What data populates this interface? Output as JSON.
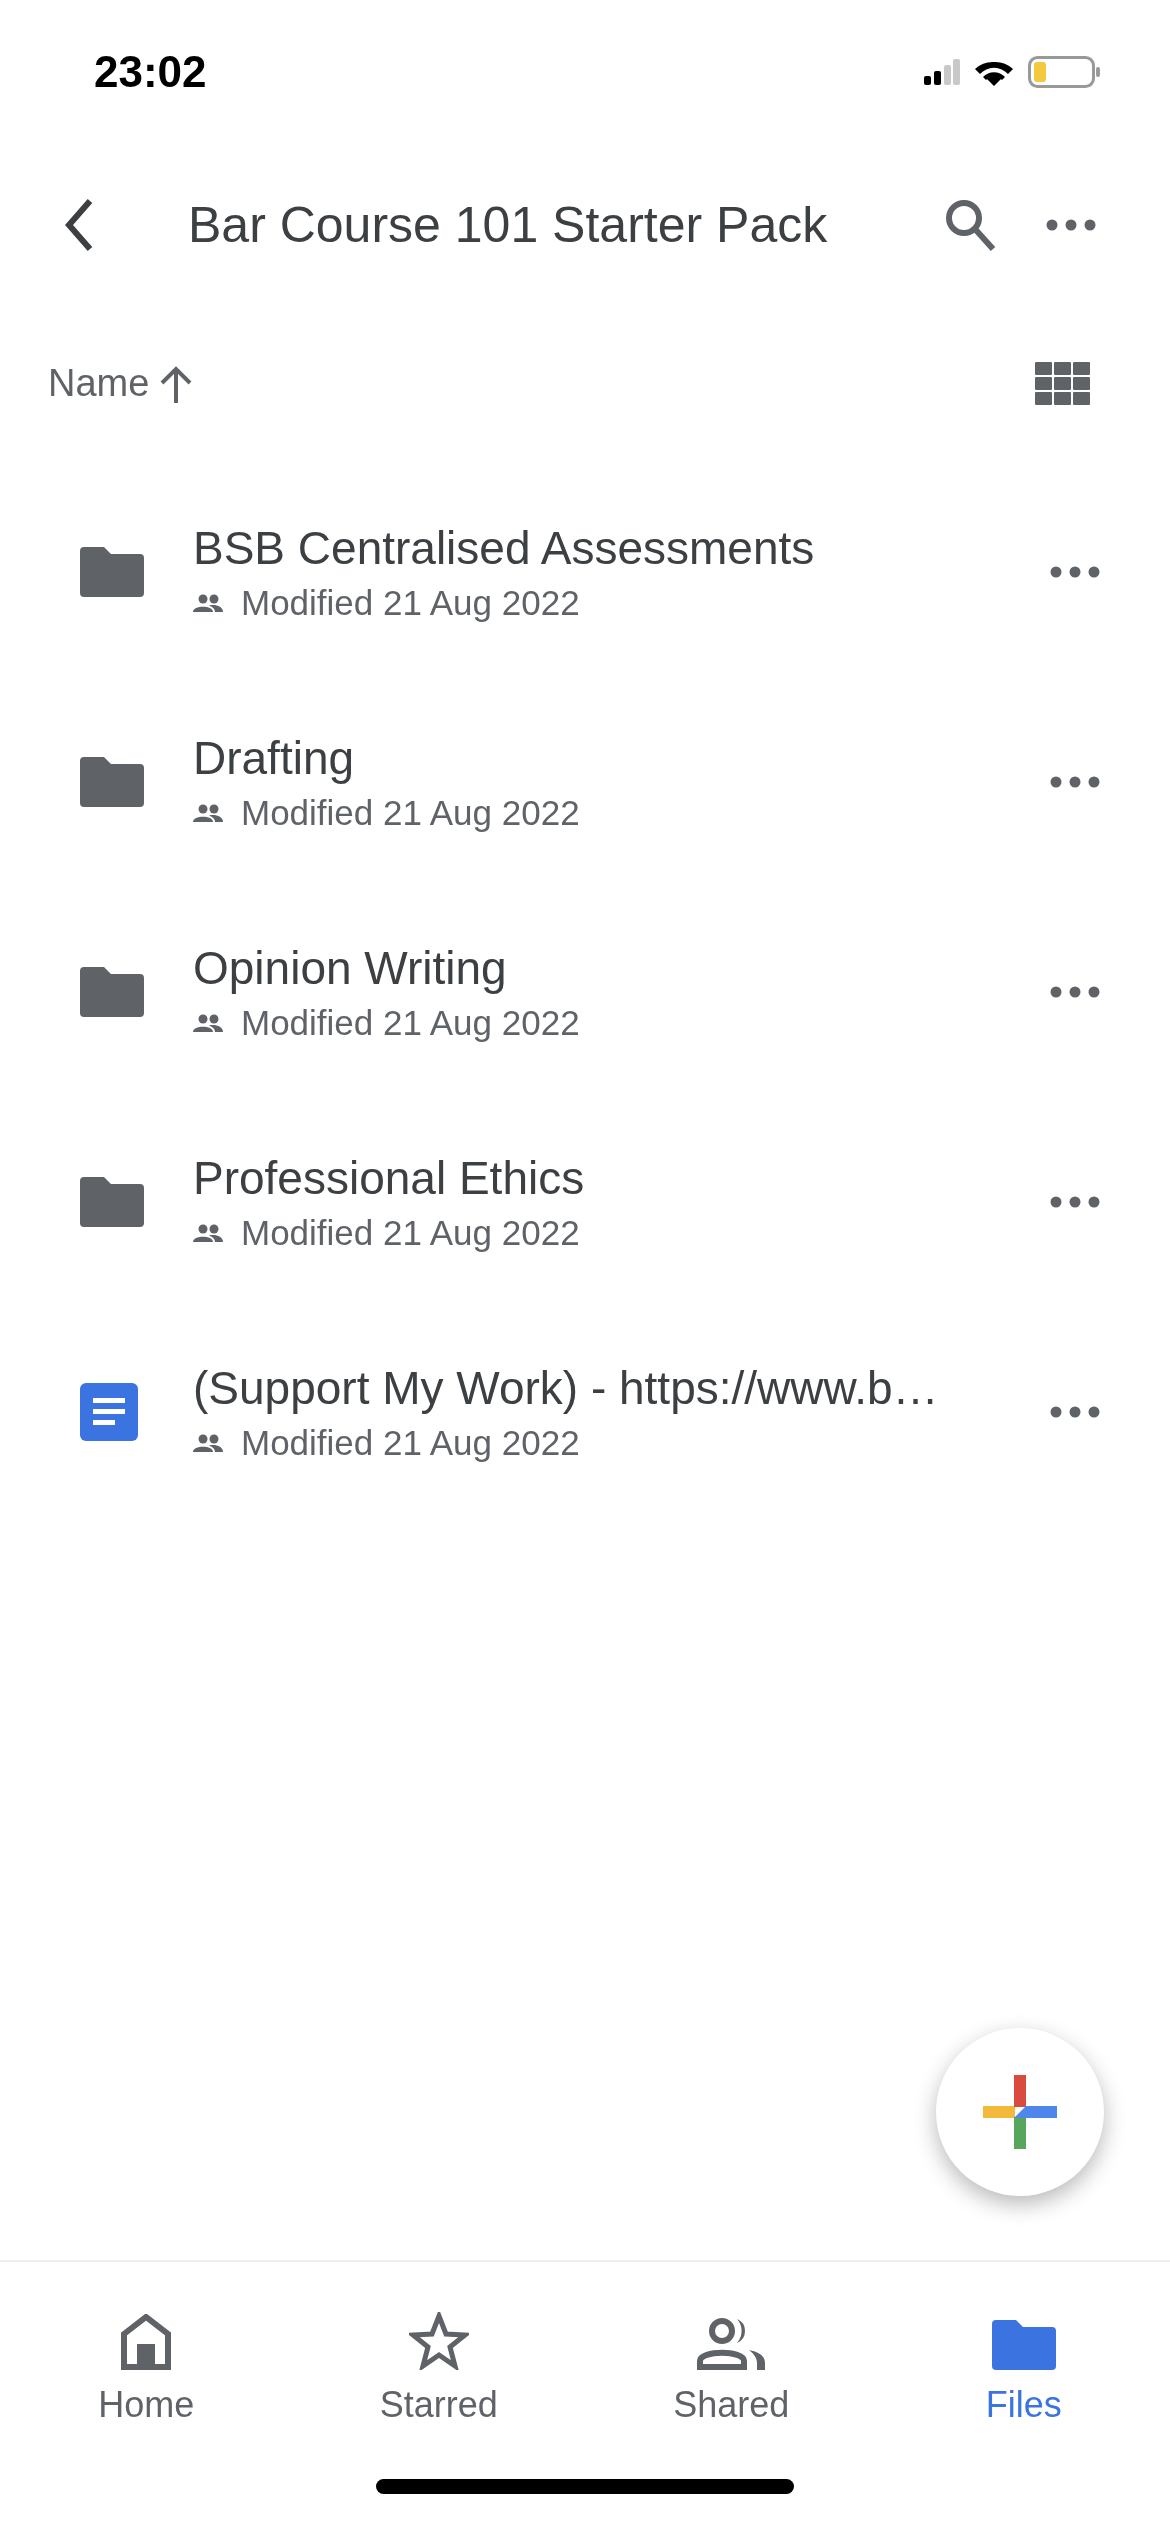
{
  "status_bar": {
    "time": "23:02"
  },
  "header": {
    "title": "Bar Course 101 Starter Pack"
  },
  "sort": {
    "label": "Name"
  },
  "files": [
    {
      "kind": "folder",
      "name": "BSB Centralised Assessments",
      "meta": "Modified 21 Aug 2022",
      "shared": true
    },
    {
      "kind": "folder",
      "name": "Drafting",
      "meta": "Modified 21 Aug 2022",
      "shared": true
    },
    {
      "kind": "folder",
      "name": "Opinion Writing",
      "meta": "Modified 21 Aug 2022",
      "shared": true
    },
    {
      "kind": "folder",
      "name": "Professional Ethics",
      "meta": "Modified 21 Aug 2022",
      "shared": true
    },
    {
      "kind": "doc",
      "name": "(Support My Work) - https://www.b…",
      "meta": "Modified 21 Aug 2022",
      "shared": true
    }
  ],
  "bottom_nav": [
    {
      "kind": "home",
      "label": "Home",
      "selected": false
    },
    {
      "kind": "star",
      "label": "Starred",
      "selected": false
    },
    {
      "kind": "people",
      "label": "Shared",
      "selected": false
    },
    {
      "kind": "folder",
      "label": "Files",
      "selected": true
    }
  ]
}
